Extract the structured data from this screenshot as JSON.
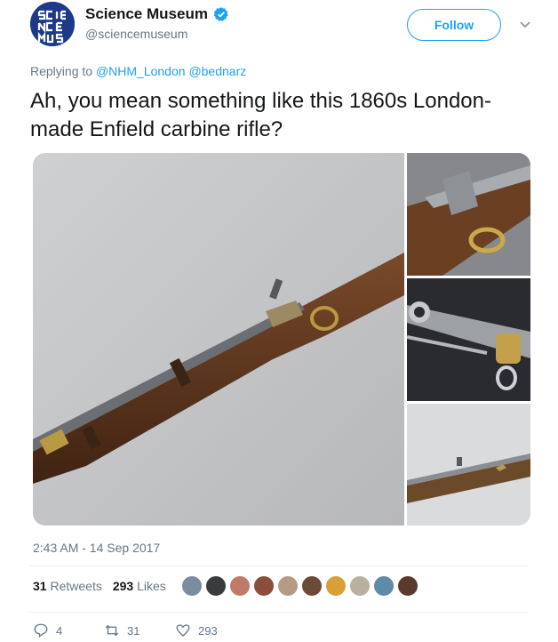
{
  "account": {
    "display_name": "Science Museum",
    "handle": "@sciencemuseum",
    "avatar_text": "SCIENCE MUSEUM",
    "verified": true,
    "follow_label": "Follow"
  },
  "reply": {
    "prefix": "Replying to",
    "mentions": [
      "@NHM_London",
      "@bednarz"
    ]
  },
  "tweet": {
    "text": "Ah, you mean something like this 1860s London-made Enfield carbine rifle?",
    "timestamp": "2:43 AM - 14 Sep 2017"
  },
  "media": {
    "count": 4
  },
  "stats": {
    "retweets_count": "31",
    "retweets_label": "Retweets",
    "likes_count": "293",
    "likes_label": "Likes",
    "liker_avatar_colors": [
      "#7a8d9e",
      "#3a3b3c",
      "#c07a68",
      "#8a4e3a",
      "#b59a86",
      "#6d4a36",
      "#d8a038",
      "#b8b0a0",
      "#5f8aa8",
      "#5a3a2a"
    ]
  },
  "actions": {
    "reply_count": "4",
    "retweet_count": "31",
    "like_count": "293"
  },
  "colors": {
    "accent": "#1da1f2",
    "muted": "#657786",
    "text": "#14171a"
  }
}
